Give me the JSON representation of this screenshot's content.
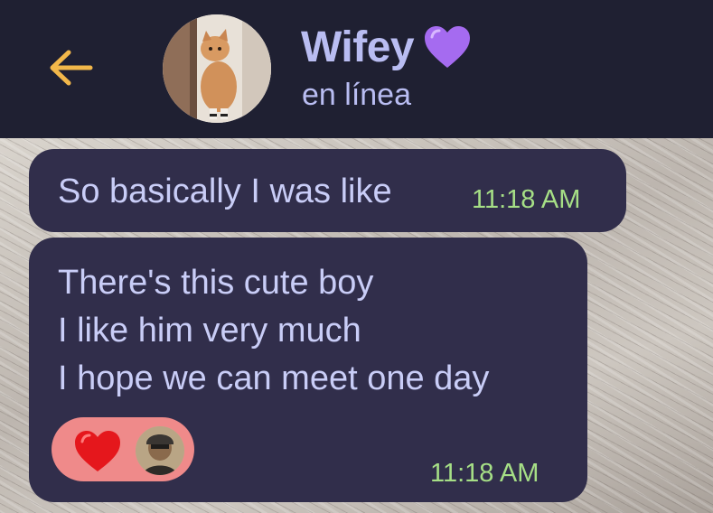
{
  "header": {
    "contact_name": "Wifey",
    "status": "en línea",
    "name_emoji": "purple-heart-icon",
    "colors": {
      "header_bg": "#1f2032",
      "accent_text": "#b9bdf2",
      "back_arrow": "#f2b74a"
    }
  },
  "messages": [
    {
      "text": "So basically I was like",
      "time": "11:18 AM"
    },
    {
      "lines": [
        "There's this cute boy",
        "I like him very much",
        "I hope we can meet one day"
      ],
      "time": "11:18 AM",
      "reactions": [
        "red-heart-icon",
        "reactor-avatar"
      ]
    }
  ],
  "colors": {
    "bubble_bg": "#312e4b",
    "bubble_text": "#c9cdf7",
    "timestamp": "#a6df86",
    "reaction_pill": "#ef8a8a"
  }
}
